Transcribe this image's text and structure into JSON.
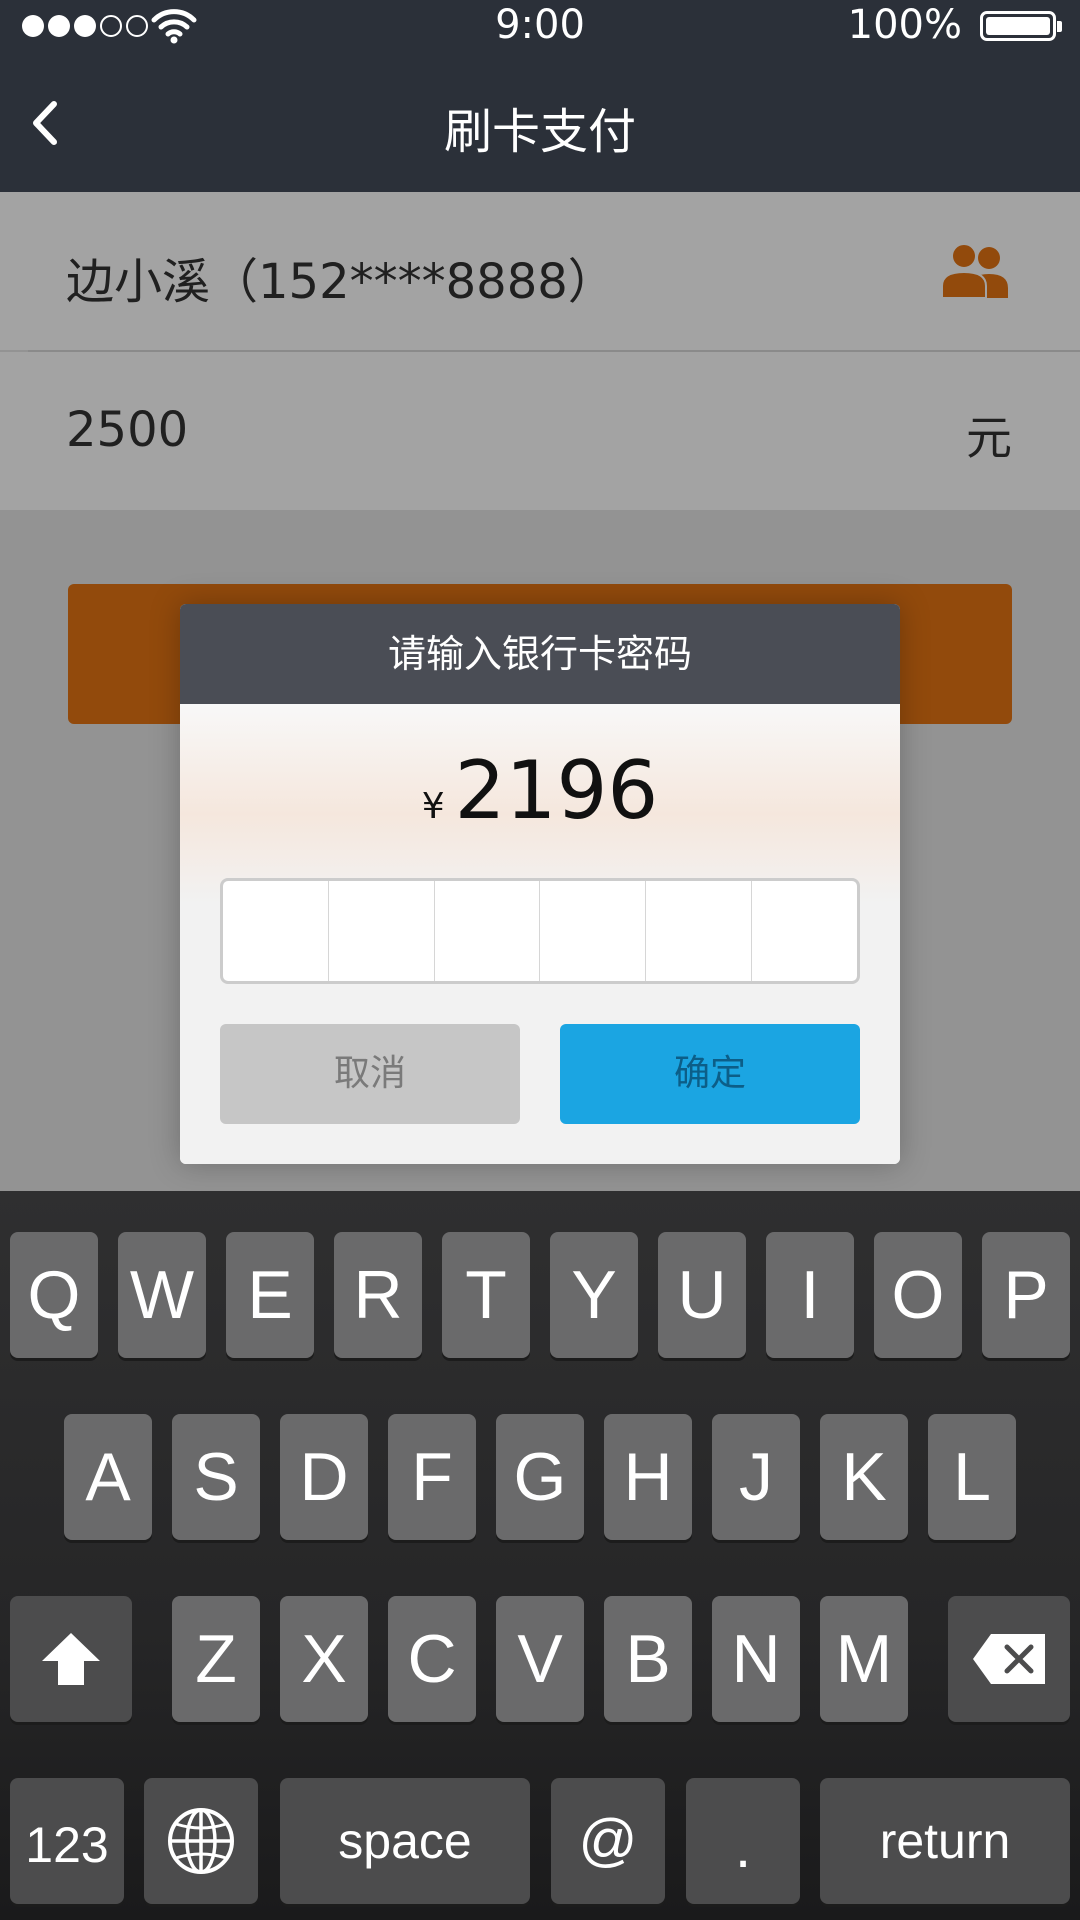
{
  "status_bar": {
    "time": "9:00",
    "battery": "100%"
  },
  "nav": {
    "title": "刷卡支付"
  },
  "form": {
    "payer": "边小溪（152****8888）",
    "amount_value": "2500",
    "unit": "元"
  },
  "dialog": {
    "title": "请输入银行卡密码",
    "currency_symbol": "¥",
    "amount": "2196",
    "cancel_label": "取消",
    "confirm_label": "确定"
  },
  "keyboard": {
    "row1": [
      "Q",
      "W",
      "E",
      "R",
      "T",
      "Y",
      "U",
      "I",
      "O",
      "P"
    ],
    "row2": [
      "A",
      "S",
      "D",
      "F",
      "G",
      "H",
      "J",
      "K",
      "L"
    ],
    "row3": [
      "Z",
      "X",
      "C",
      "V",
      "B",
      "N",
      "M"
    ],
    "numbers_label": "123",
    "space_label": "space",
    "at_label": "@",
    "dot_label": ".",
    "return_label": "return"
  },
  "colors": {
    "nav_bg": "#2b3039",
    "accent_orange": "#e57513",
    "confirm_blue": "#1ba5e2",
    "dialog_header": "#4a4d55"
  },
  "icons": [
    "wifi-icon",
    "battery-icon",
    "back-arrow-icon",
    "contacts-icon",
    "shift-icon",
    "backspace-icon",
    "globe-icon"
  ]
}
